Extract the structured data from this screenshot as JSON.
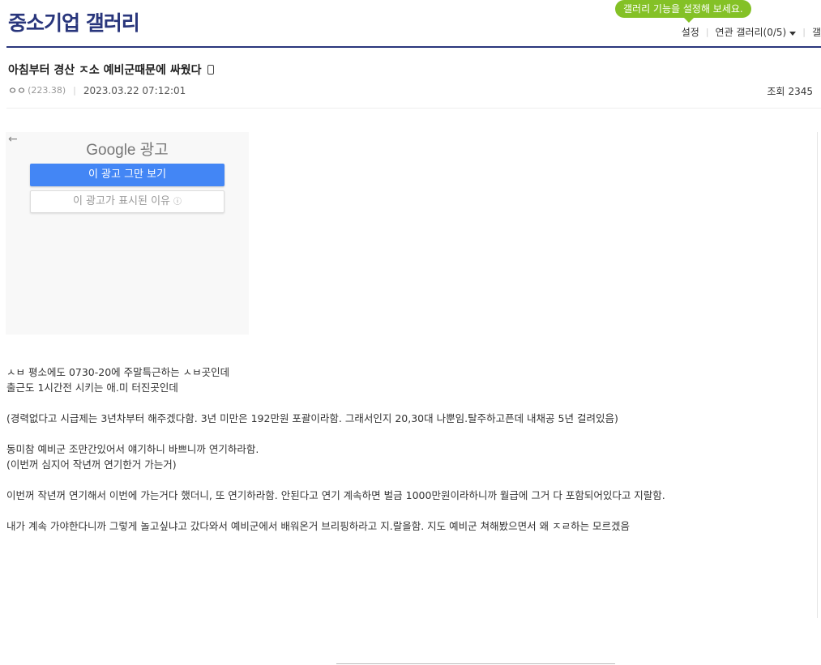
{
  "gallery": {
    "title": "중소기업 갤러리"
  },
  "tooltip": {
    "text": "갤러리 기능을 설정해 보세요."
  },
  "top_links": {
    "settings": "설정",
    "related": "연관 갤러리(0/5)",
    "truncated": "갤"
  },
  "post": {
    "title": "아침부터 경산 ㅈ소 예비군때문에 싸웠다",
    "author": "ㅇㅇ",
    "ip": "(223.38)",
    "date": "2023.03.22 07:12:01",
    "views_label": "조회",
    "views": "2345",
    "icon": "mobile-icon"
  },
  "ad": {
    "brand": "Google 광고",
    "stop_label": "이 광고 그만 보기",
    "why_label": "이 광고가 표시된 이유",
    "info_glyph": "ⓘ",
    "back_glyph": "←",
    "stop_color": "#4386f5"
  },
  "body": {
    "lines": [
      "ㅅㅂ 평소에도 0730-20에 주말특근하는 ㅅㅂ곳인데",
      "출근도 1시간전 시키는 애.미 터진곳인데",
      "(경력없다고 시급제는 3년차부터 해주겠다함. 3년 미만은 192만원 포괄이라함. 그래서인지 20,30대 나뿐임.탈주하고픈데 내채공 5년 걸려있음)",
      "동미참 예비군 조만간있어서 얘기하니 바쁘니까 연기하라함.",
      "(이번꺼 심지어 작년꺼 연기한거 가는거)",
      "이번꺼 작년꺼 연기해서 이번에 가는거다 했더니, 또 연기하라함. 안된다고 연기 계속하면 벌금 1000만원이라하니까 월급에 그거 다 포함되어있다고 지랄함.",
      "내가 계속 가야한다니까 그렇게 놀고싶냐고 갔다와서 예비군에서 배워온거 브리핑하라고 지.랄을함. 지도 예비군 쳐해봤으면서 왜 ㅈㄹ하는 모르겠음"
    ]
  },
  "colors": {
    "brand": "#29367c",
    "tooltip": "#84c126"
  }
}
